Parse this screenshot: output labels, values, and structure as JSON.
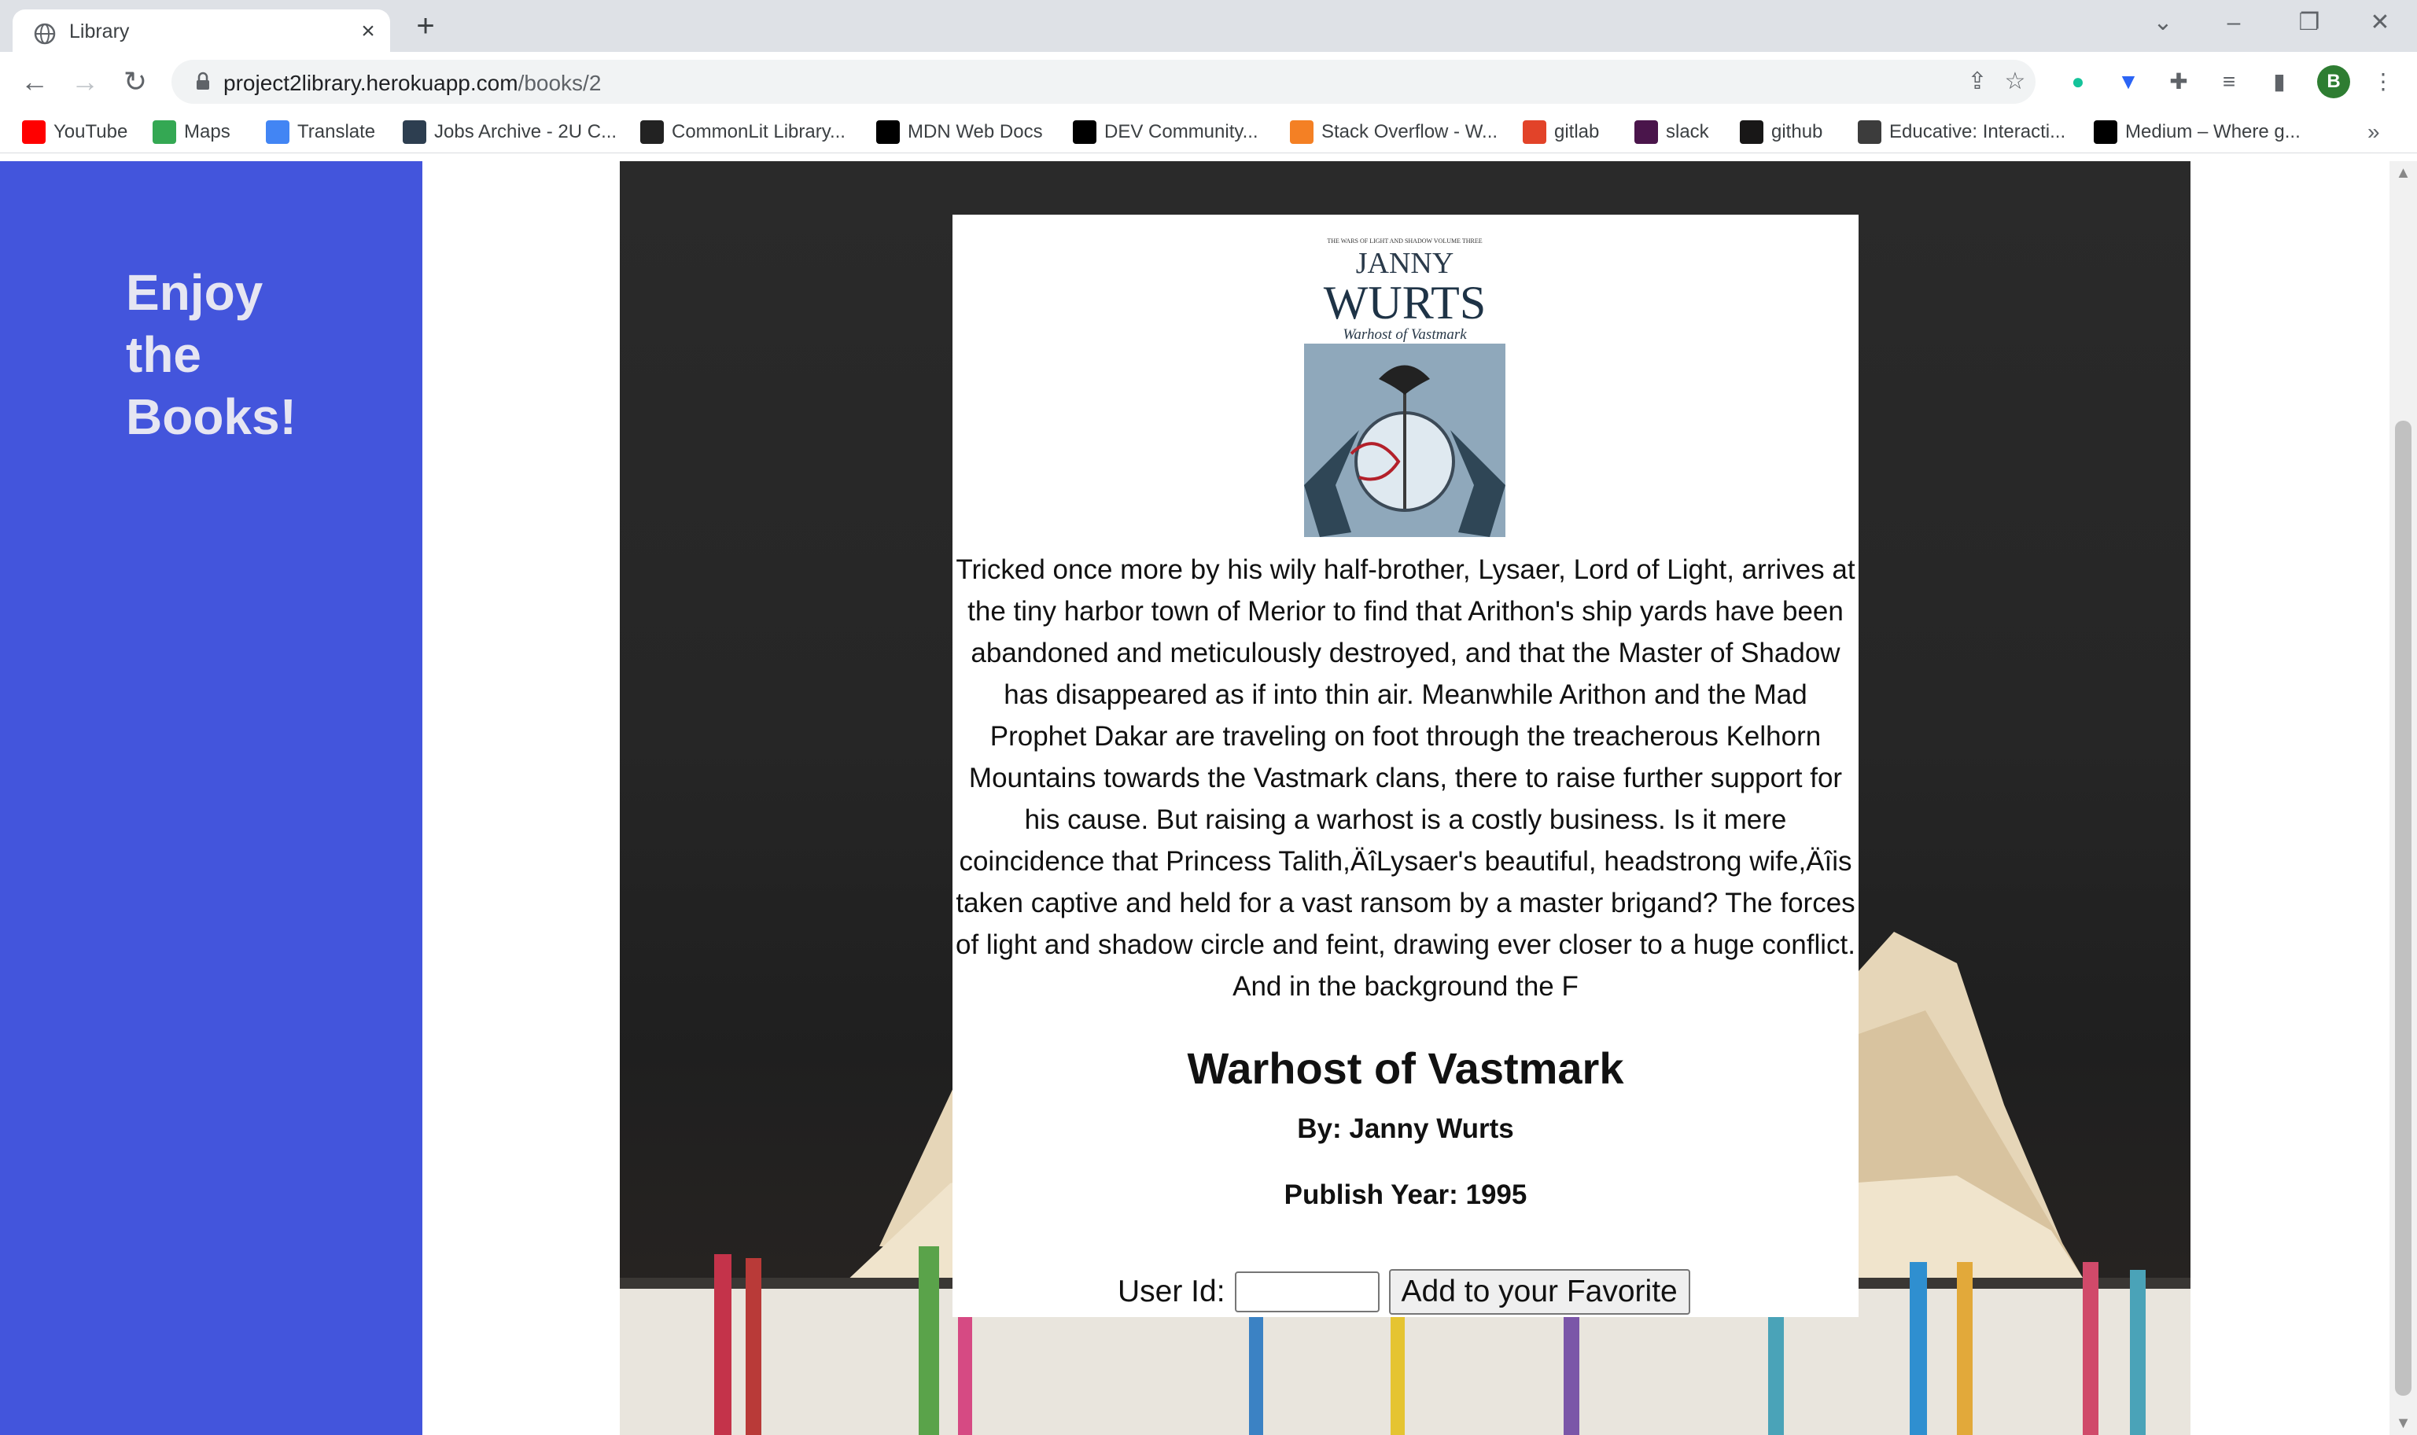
{
  "browser": {
    "tab_title": "Library",
    "tab_close": "×",
    "new_tab": "+",
    "url_host": "project2library.herokuapp.com",
    "url_path": "/books/2",
    "profile_initial": "B",
    "bookmarks": [
      {
        "label": "YouTube",
        "icon": "youtube-icon",
        "color": "#ff0000"
      },
      {
        "label": "Maps",
        "icon": "maps-icon",
        "color": "#34a853"
      },
      {
        "label": "Translate",
        "icon": "translate-icon",
        "color": "#4285f4"
      },
      {
        "label": "Jobs Archive - 2U C...",
        "icon": "jobs-icon",
        "color": "#2d3e50"
      },
      {
        "label": "CommonLit Library...",
        "icon": "book-icon",
        "color": "#222222"
      },
      {
        "label": "MDN Web Docs",
        "icon": "mdn-icon",
        "color": "#000000"
      },
      {
        "label": "DEV Community...",
        "icon": "dev-icon",
        "color": "#000000"
      },
      {
        "label": "Stack Overflow - W...",
        "icon": "stackoverflow-icon",
        "color": "#f48024"
      },
      {
        "label": "gitlab",
        "icon": "gitlab-icon",
        "color": "#e24329"
      },
      {
        "label": "slack",
        "icon": "slack-icon",
        "color": "#4a154b"
      },
      {
        "label": "github",
        "icon": "github-icon",
        "color": "#181717"
      },
      {
        "label": "Educative: Interacti...",
        "icon": "educative-icon",
        "color": "#3c3c3c"
      },
      {
        "label": "Medium – Where g...",
        "icon": "medium-icon",
        "color": "#000000"
      }
    ],
    "bookmarks_more": "»"
  },
  "sidebar": {
    "title": "Enjoy the Books!"
  },
  "book": {
    "cover": {
      "series": "THE WARS OF LIGHT AND SHADOW VOLUME THREE",
      "author_first": "JANNY",
      "author_last": "WURTS",
      "subtitle": "Warhost of Vastmark"
    },
    "description": "Tricked once more by his wily half-brother, Lysaer, Lord of Light, arrives at the tiny harbor town of Merior to find that Arithon's ship yards have been abandoned and meticulously destroyed, and that the Master of Shadow has disappeared as if into thin air. Meanwhile Arithon and the Mad Prophet Dakar are traveling on foot through the treacherous Kelhorn Mountains towards the Vastmark clans, there to raise further support for his cause. But raising a warhost is a costly business. Is it mere coincidence that Princess Talith,ÄîLysaer's beautiful, headstrong wife,Äîis taken captive and held for a vast ransom by a master brigand? The forces of light and shadow circle and feint, drawing ever closer to a huge conflict. And in the background the F",
    "title": "Warhost of Vastmark",
    "author": "By: Janny Wurts",
    "publish_year": "Publish Year: 1995"
  },
  "favorite_form": {
    "label": "User Id:",
    "input_value": "",
    "button_label": "Add to your Favorite"
  },
  "colors": {
    "sidebar_bg": "#4355dc",
    "sidebar_text": "#e6e6f2"
  }
}
